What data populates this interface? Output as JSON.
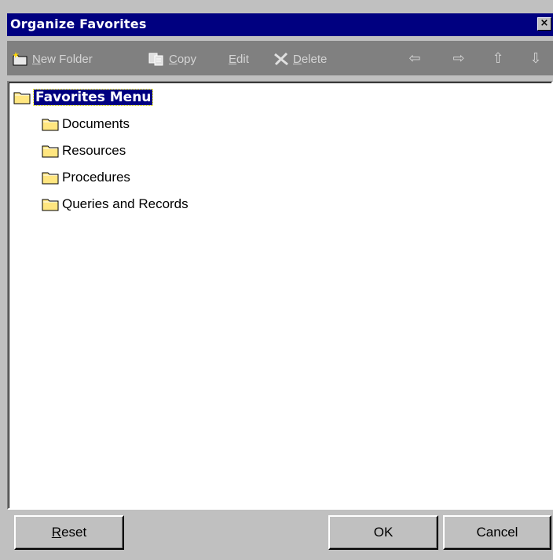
{
  "window": {
    "title": "Organize Favorites",
    "close_glyph": "×"
  },
  "toolbar": {
    "new_folder": {
      "mnemonic": "N",
      "rest": "ew Folder",
      "icon": "new-folder-icon"
    },
    "copy": {
      "mnemonic": "C",
      "rest": "opy",
      "icon": "copy-icon"
    },
    "edit": {
      "mnemonic": "E",
      "rest": "dit"
    },
    "delete": {
      "mnemonic": "D",
      "rest": "elete",
      "icon": "delete-icon"
    },
    "arrows": [
      {
        "name": "move-left-icon",
        "glyph": "⇦"
      },
      {
        "name": "move-right-icon",
        "glyph": "⇨"
      },
      {
        "name": "move-up-icon",
        "glyph": "⇧"
      },
      {
        "name": "move-down-icon",
        "glyph": "⇩"
      }
    ]
  },
  "tree": {
    "root": "Favorites Menu",
    "children": [
      "Documents",
      "Resources",
      "Procedures",
      "Queries and Records"
    ]
  },
  "buttons": {
    "reset": {
      "mnemonic": "R",
      "rest": "eset"
    },
    "ok": "OK",
    "cancel": "Cancel"
  },
  "colors": {
    "titlebar": "#000080",
    "toolbar": "#808080",
    "face": "#c0c0c0",
    "selection": "#000080",
    "folder": "#ffe680"
  }
}
